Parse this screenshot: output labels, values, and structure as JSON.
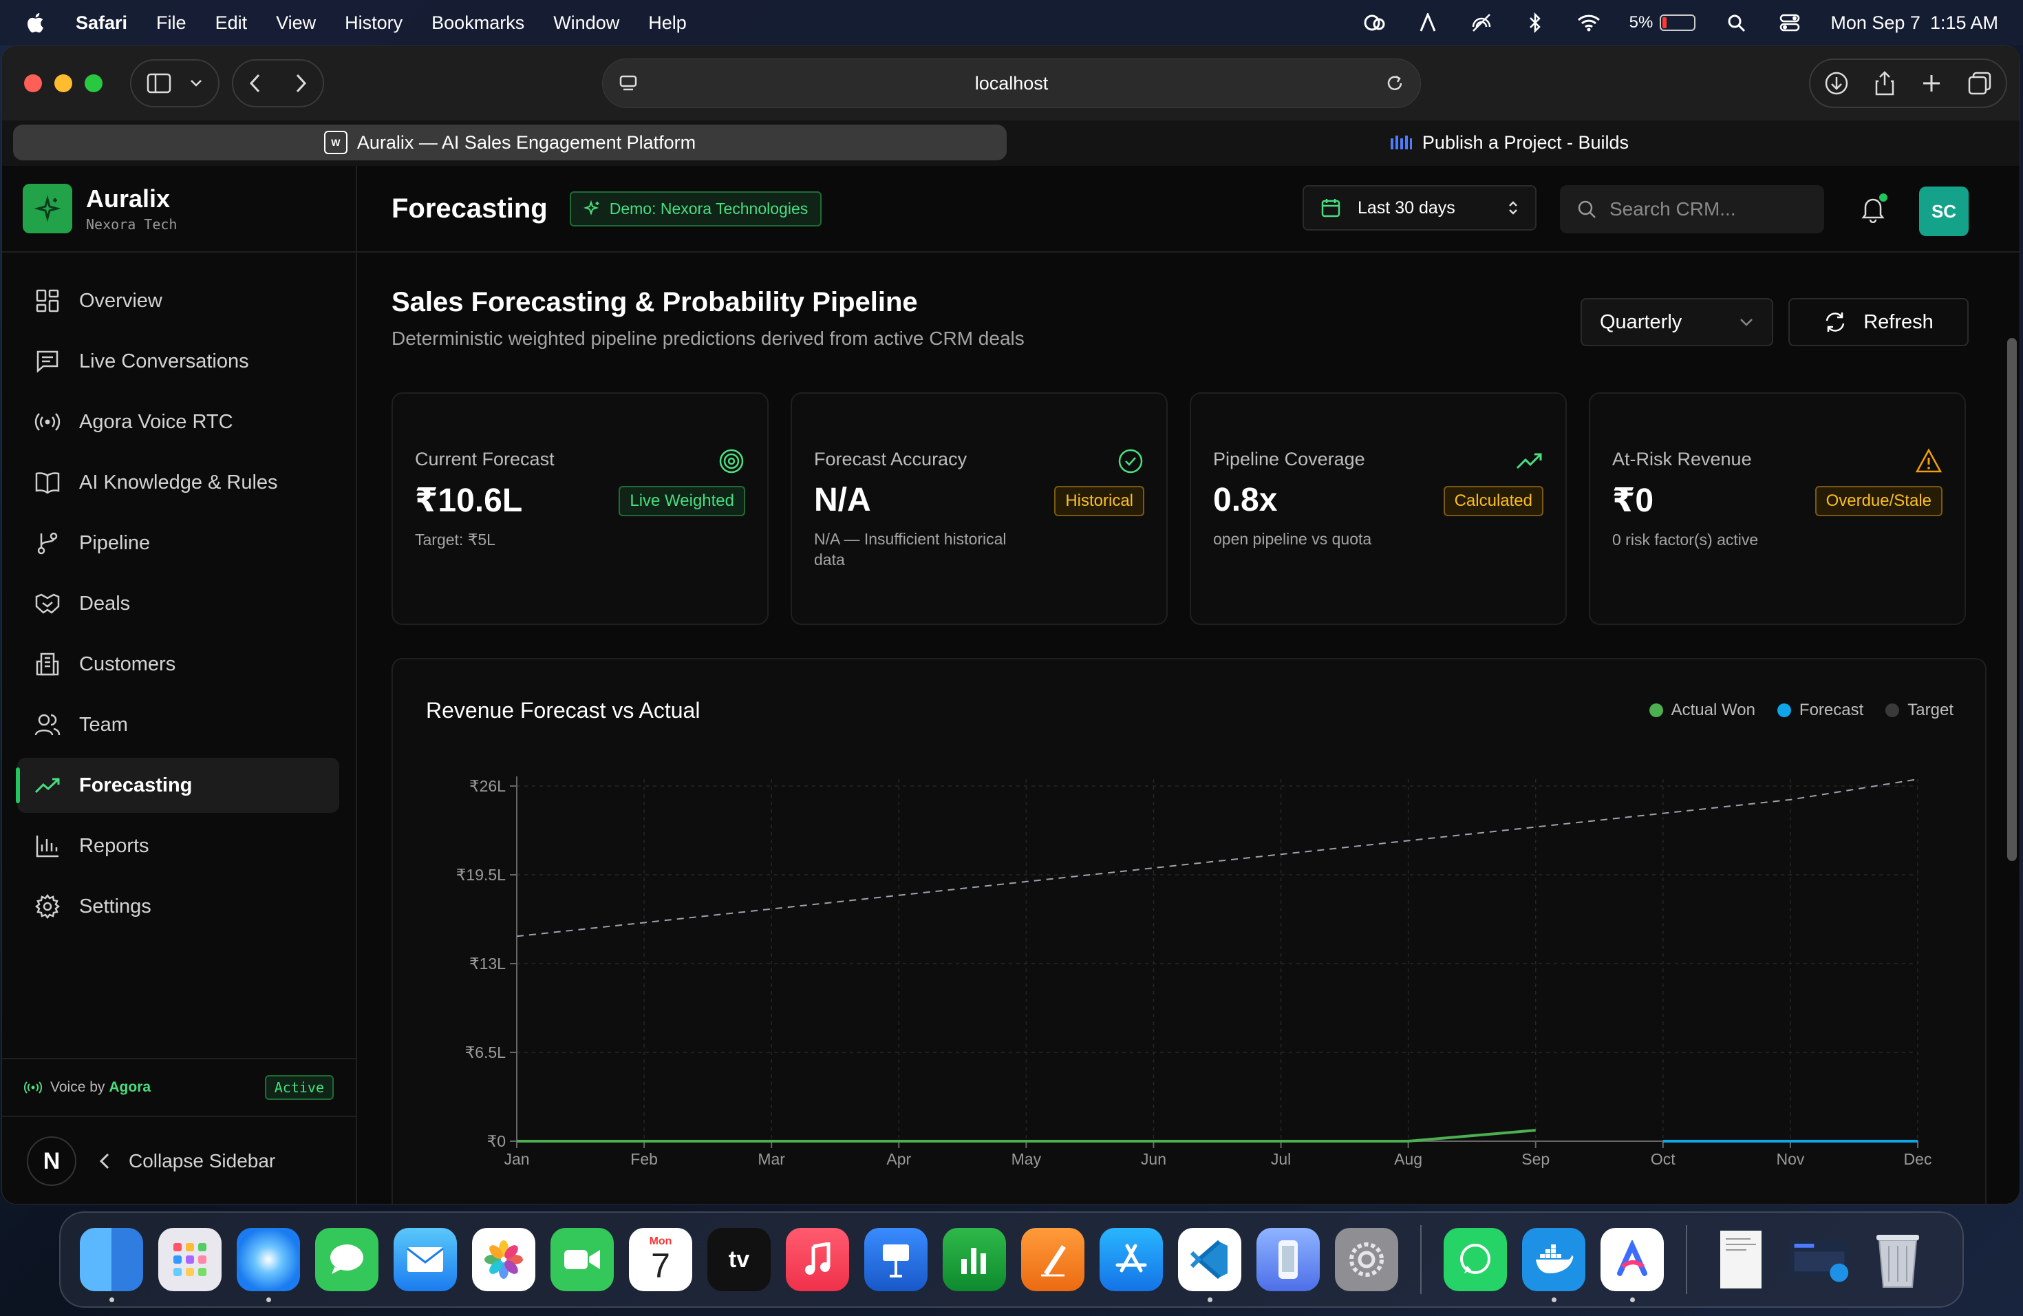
{
  "menubar": {
    "app": "Safari",
    "items": [
      "File",
      "Edit",
      "View",
      "History",
      "Bookmarks",
      "Window",
      "Help"
    ],
    "battery_pct": "5%",
    "date": "Mon Sep 7",
    "time": "1:15 AM"
  },
  "browser": {
    "url": "localhost",
    "tabs": [
      {
        "label": "Auralix — AI Sales Engagement Platform",
        "active": true
      },
      {
        "label": "Publish a Project - Builds",
        "active": false
      }
    ]
  },
  "sidebar": {
    "brand": "Auralix",
    "org": "Nexora Tech",
    "items": [
      {
        "label": "Overview",
        "icon": "grid-icon"
      },
      {
        "label": "Live Conversations",
        "icon": "chat-icon"
      },
      {
        "label": "Agora Voice RTC",
        "icon": "broadcast-icon"
      },
      {
        "label": "AI Knowledge & Rules",
        "icon": "book-icon"
      },
      {
        "label": "Pipeline",
        "icon": "branch-icon"
      },
      {
        "label": "Deals",
        "icon": "handshake-icon"
      },
      {
        "label": "Customers",
        "icon": "building-icon"
      },
      {
        "label": "Team",
        "icon": "users-icon"
      },
      {
        "label": "Forecasting",
        "icon": "trend-icon",
        "active": true
      },
      {
        "label": "Reports",
        "icon": "bar-chart-icon"
      },
      {
        "label": "Settings",
        "icon": "gear-icon"
      }
    ],
    "voice_label": "Voice by",
    "voice_provider": "Agora",
    "voice_status": "Active",
    "collapse_label": "Collapse Sidebar",
    "avatar_letter": "N"
  },
  "header": {
    "title": "Forecasting",
    "demo_badge": "Demo: Nexora Technologies",
    "date_range": "Last 30 days",
    "search_placeholder": "Search CRM...",
    "user_initials": "SC"
  },
  "section": {
    "title": "Sales Forecasting & Probability Pipeline",
    "subtitle": "Deterministic weighted pipeline predictions derived from active CRM deals",
    "period": "Quarterly",
    "refresh_label": "Refresh"
  },
  "kpis": [
    {
      "label": "Current Forecast",
      "value": "₹10.6L",
      "badge": "Live Weighted",
      "note": "Target: ₹5L",
      "tone": "green",
      "icon": "target-icon"
    },
    {
      "label": "Forecast Accuracy",
      "value": "N/A",
      "badge": "Historical",
      "note": "N/A — Insufficient historical data",
      "tone": "amber",
      "icon": "check-circle-icon"
    },
    {
      "label": "Pipeline Coverage",
      "value": "0.8x",
      "badge": "Calculated",
      "note": "open pipeline vs quota",
      "tone": "amber",
      "icon": "trend-up-icon"
    },
    {
      "label": "At-Risk Revenue",
      "value": "₹0",
      "badge": "Overdue/Stale",
      "note": "0 risk factor(s) active",
      "tone": "amber",
      "icon": "warning-icon"
    }
  ],
  "colors": {
    "accent": "#22c55e",
    "actual": "#4caf50",
    "forecast": "#0ea5e9",
    "target": "#9ca3af",
    "warning": "#f59e0b"
  },
  "chart_data": {
    "type": "line",
    "title": "Revenue Forecast vs Actual",
    "categories": [
      "Jan",
      "Feb",
      "Mar",
      "Apr",
      "May",
      "Jun",
      "Jul",
      "Aug",
      "Sep",
      "Oct",
      "Nov",
      "Dec"
    ],
    "y_ticks": [
      "₹0",
      "₹6.5L",
      "₹13L",
      "₹19.5L",
      "₹26L"
    ],
    "y_tick_values": [
      0,
      6.5,
      13,
      19.5,
      26
    ],
    "ylim": [
      0,
      26
    ],
    "grid": true,
    "legend_position": "top-right",
    "series": [
      {
        "name": "Actual Won",
        "style": "solid",
        "values": [
          0,
          0,
          0,
          0,
          0,
          0,
          0,
          0,
          0.8,
          null,
          null,
          null
        ]
      },
      {
        "name": "Forecast",
        "style": "solid",
        "values": [
          null,
          null,
          null,
          null,
          null,
          null,
          null,
          null,
          null,
          0,
          0,
          0
        ]
      },
      {
        "name": "Target",
        "style": "dashed",
        "values": [
          15,
          16,
          17,
          18,
          19,
          20,
          21,
          22,
          23,
          24,
          25,
          26.5
        ]
      }
    ]
  }
}
